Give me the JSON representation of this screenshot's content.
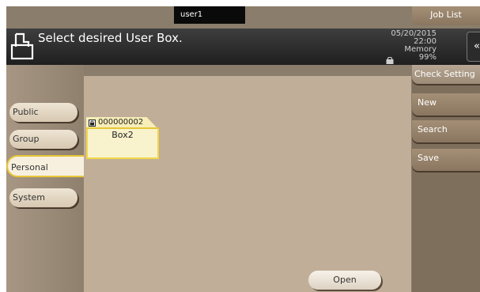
{
  "topbar": {
    "user": "user1",
    "job_list_label": "Job List"
  },
  "header": {
    "title": "Select desired User Box.",
    "date": "05/20/2015",
    "time": "22:00",
    "memory_label": "Memory",
    "memory_value": "99%",
    "back_icon": "double-chevron-left-icon"
  },
  "left_tabs": [
    {
      "label": "Public"
    },
    {
      "label": "Group"
    },
    {
      "label": "Personal",
      "selected": true
    },
    {
      "label": "System"
    }
  ],
  "user_box": {
    "number": "000000002",
    "name": "Box2",
    "icon": "lock-icon"
  },
  "main": {
    "open_label": "Open"
  },
  "right_panel": {
    "check_setting_label": "Check Setting",
    "new_label": "New",
    "search_label": "Search",
    "save_label": "Save"
  },
  "colors": {
    "background": "#8b7d6b",
    "header": "#2a2a2a",
    "main_area": "#c1ae99",
    "selected_accent": "#e6c638",
    "user_box": "#f8f3cc"
  }
}
